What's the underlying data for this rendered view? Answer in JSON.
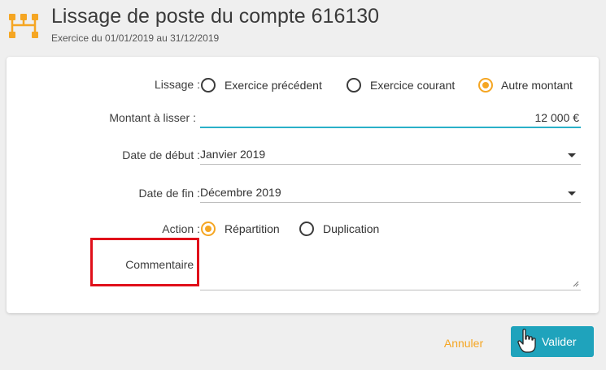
{
  "header": {
    "title": "Lissage de poste du compte 616130",
    "subtitle": "Exercice du 01/01/2019 au 31/12/2019",
    "logo_icon": "org-chart-icon",
    "logo_color": "#f5a623"
  },
  "form": {
    "lissage": {
      "label": "Lissage :",
      "options": [
        {
          "label": "Exercice précédent",
          "checked": false
        },
        {
          "label": "Exercice courant",
          "checked": false
        },
        {
          "label": "Autre montant",
          "checked": true
        }
      ]
    },
    "montant": {
      "label": "Montant à lisser :",
      "value": "12 000 €"
    },
    "date_debut": {
      "label": "Date de début :",
      "value": "Janvier 2019"
    },
    "date_fin": {
      "label": "Date de fin :",
      "value": "Décembre 2019"
    },
    "action": {
      "label": "Action :",
      "options": [
        {
          "label": "Répartition",
          "checked": true
        },
        {
          "label": "Duplication",
          "checked": false
        }
      ]
    },
    "commentaire": {
      "label": "Commentaire :",
      "value": ""
    }
  },
  "buttons": {
    "cancel": "Annuler",
    "ok": "Valider"
  },
  "colors": {
    "accent": "#f5a623",
    "primary": "#1fa3bc",
    "highlight": "#e0101a",
    "focus_underline": "#2ab0c8"
  }
}
